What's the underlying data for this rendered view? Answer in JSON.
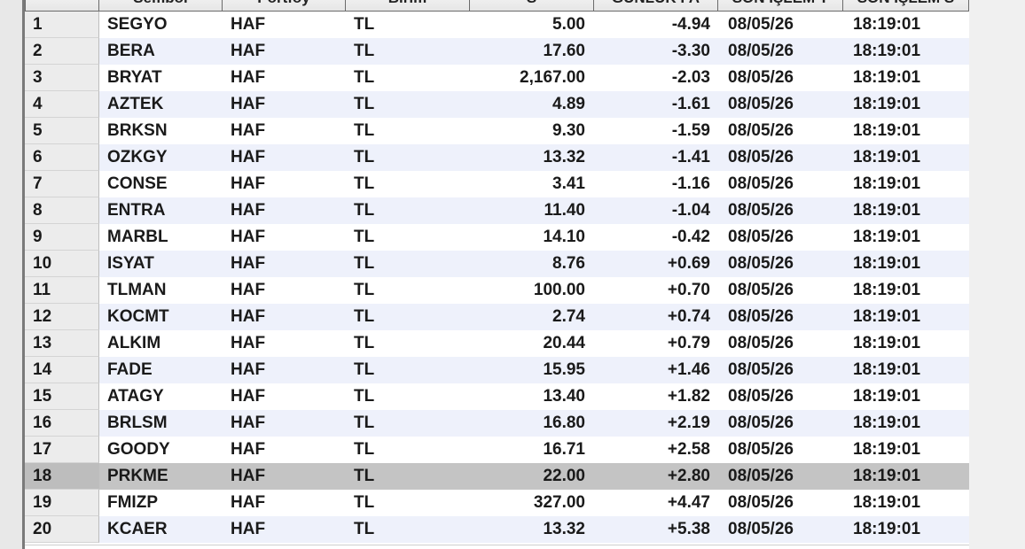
{
  "grid": {
    "headers": [
      "",
      "Sembol",
      "Portföy",
      "Birim",
      "S",
      "GÜNLÜK FA",
      "SON İŞLEM T",
      "SON İŞLEM S"
    ],
    "selected_row": 18,
    "rows": [
      {
        "idx": "1",
        "symbol": "SEGYO",
        "portfolio": "HAF",
        "unit": "TL",
        "price": "5.00",
        "change": "-4.94",
        "date": "08/05/26",
        "time": "18:19:01"
      },
      {
        "idx": "2",
        "symbol": "BERA",
        "portfolio": "HAF",
        "unit": "TL",
        "price": "17.60",
        "change": "-3.30",
        "date": "08/05/26",
        "time": "18:19:01"
      },
      {
        "idx": "3",
        "symbol": "BRYAT",
        "portfolio": "HAF",
        "unit": "TL",
        "price": "2,167.00",
        "change": "-2.03",
        "date": "08/05/26",
        "time": "18:19:01"
      },
      {
        "idx": "4",
        "symbol": "AZTEK",
        "portfolio": "HAF",
        "unit": "TL",
        "price": "4.89",
        "change": "-1.61",
        "date": "08/05/26",
        "time": "18:19:01"
      },
      {
        "idx": "5",
        "symbol": "BRKSN",
        "portfolio": "HAF",
        "unit": "TL",
        "price": "9.30",
        "change": "-1.59",
        "date": "08/05/26",
        "time": "18:19:01"
      },
      {
        "idx": "6",
        "symbol": "OZKGY",
        "portfolio": "HAF",
        "unit": "TL",
        "price": "13.32",
        "change": "-1.41",
        "date": "08/05/26",
        "time": "18:19:01"
      },
      {
        "idx": "7",
        "symbol": "CONSE",
        "portfolio": "HAF",
        "unit": "TL",
        "price": "3.41",
        "change": "-1.16",
        "date": "08/05/26",
        "time": "18:19:01"
      },
      {
        "idx": "8",
        "symbol": "ENTRA",
        "portfolio": "HAF",
        "unit": "TL",
        "price": "11.40",
        "change": "-1.04",
        "date": "08/05/26",
        "time": "18:19:01"
      },
      {
        "idx": "9",
        "symbol": "MARBL",
        "portfolio": "HAF",
        "unit": "TL",
        "price": "14.10",
        "change": "-0.42",
        "date": "08/05/26",
        "time": "18:19:01"
      },
      {
        "idx": "10",
        "symbol": "ISYAT",
        "portfolio": "HAF",
        "unit": "TL",
        "price": "8.76",
        "change": "+0.69",
        "date": "08/05/26",
        "time": "18:19:01"
      },
      {
        "idx": "11",
        "symbol": "TLMAN",
        "portfolio": "HAF",
        "unit": "TL",
        "price": "100.00",
        "change": "+0.70",
        "date": "08/05/26",
        "time": "18:19:01"
      },
      {
        "idx": "12",
        "symbol": "KOCMT",
        "portfolio": "HAF",
        "unit": "TL",
        "price": "2.74",
        "change": "+0.74",
        "date": "08/05/26",
        "time": "18:19:01"
      },
      {
        "idx": "13",
        "symbol": "ALKIM",
        "portfolio": "HAF",
        "unit": "TL",
        "price": "20.44",
        "change": "+0.79",
        "date": "08/05/26",
        "time": "18:19:01"
      },
      {
        "idx": "14",
        "symbol": "FADE",
        "portfolio": "HAF",
        "unit": "TL",
        "price": "15.95",
        "change": "+1.46",
        "date": "08/05/26",
        "time": "18:19:01"
      },
      {
        "idx": "15",
        "symbol": "ATAGY",
        "portfolio": "HAF",
        "unit": "TL",
        "price": "13.40",
        "change": "+1.82",
        "date": "08/05/26",
        "time": "18:19:01"
      },
      {
        "idx": "16",
        "symbol": "BRLSM",
        "portfolio": "HAF",
        "unit": "TL",
        "price": "16.80",
        "change": "+2.19",
        "date": "08/05/26",
        "time": "18:19:01"
      },
      {
        "idx": "17",
        "symbol": "GOODY",
        "portfolio": "HAF",
        "unit": "TL",
        "price": "16.71",
        "change": "+2.58",
        "date": "08/05/26",
        "time": "18:19:01"
      },
      {
        "idx": "18",
        "symbol": "PRKME",
        "portfolio": "HAF",
        "unit": "TL",
        "price": "22.00",
        "change": "+2.80",
        "date": "08/05/26",
        "time": "18:19:01"
      },
      {
        "idx": "19",
        "symbol": "FMIZP",
        "portfolio": "HAF",
        "unit": "TL",
        "price": "327.00",
        "change": "+4.47",
        "date": "08/05/26",
        "time": "18:19:01"
      },
      {
        "idx": "20",
        "symbol": "KCAER",
        "portfolio": "HAF",
        "unit": "TL",
        "price": "13.32",
        "change": "+5.38",
        "date": "08/05/26",
        "time": "18:19:01"
      }
    ]
  }
}
